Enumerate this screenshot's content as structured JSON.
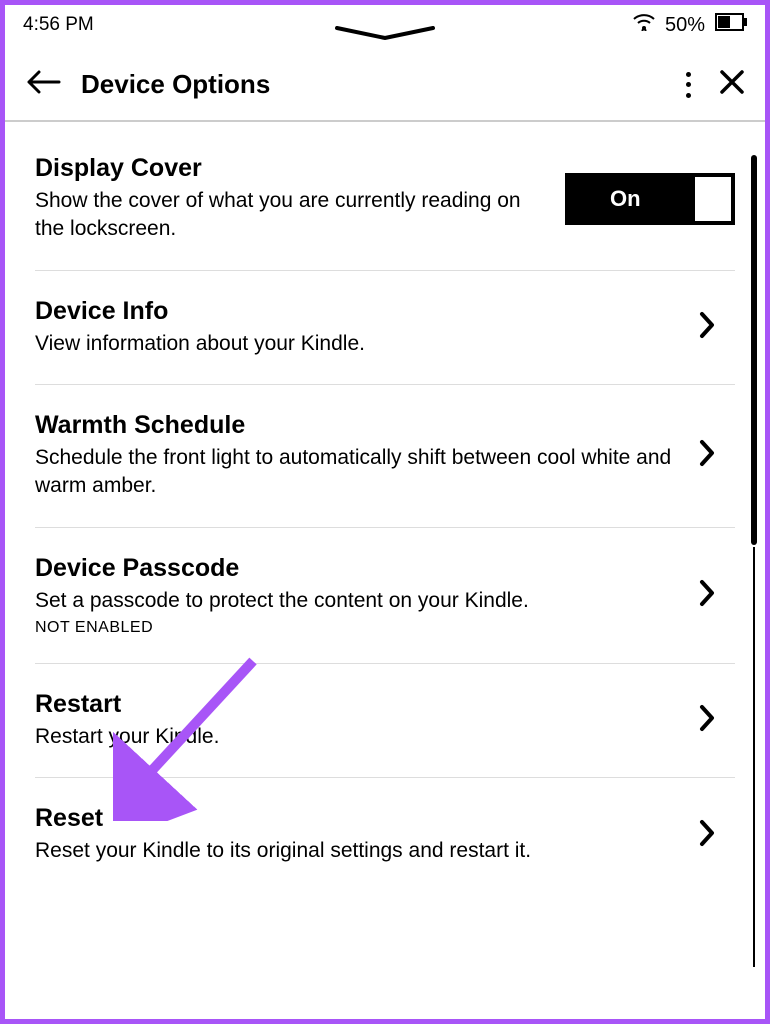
{
  "status": {
    "time": "4:56 PM",
    "battery_percent": "50%"
  },
  "header": {
    "title": "Device Options"
  },
  "settings": {
    "display_cover": {
      "title": "Display Cover",
      "desc": "Show the cover of what you are currently reading on the lockscreen.",
      "toggle_label": "On"
    },
    "device_info": {
      "title": "Device Info",
      "desc": "View information about your Kindle."
    },
    "warmth_schedule": {
      "title": "Warmth Schedule",
      "desc": "Schedule the front light to automatically shift between cool white and warm amber."
    },
    "device_passcode": {
      "title": "Device Passcode",
      "desc": "Set a passcode to protect the content on your Kindle.",
      "status": "NOT ENABLED"
    },
    "restart": {
      "title": "Restart",
      "desc": "Restart your Kindle."
    },
    "reset": {
      "title": "Reset",
      "desc": "Reset your Kindle to its original settings and restart it."
    }
  }
}
